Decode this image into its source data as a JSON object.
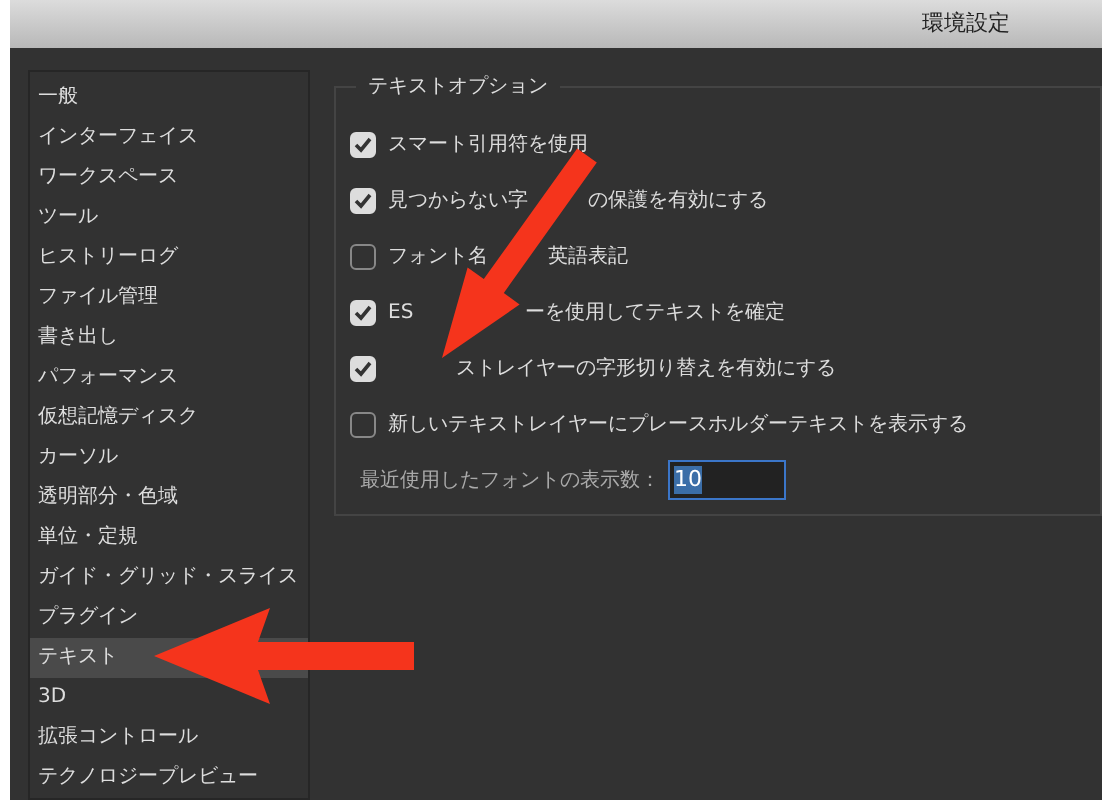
{
  "window": {
    "title": "環境設定"
  },
  "sidebar": {
    "items": [
      {
        "label": "一般",
        "selected": false
      },
      {
        "label": "インターフェイス",
        "selected": false
      },
      {
        "label": "ワークスペース",
        "selected": false
      },
      {
        "label": "ツール",
        "selected": false
      },
      {
        "label": "ヒストリーログ",
        "selected": false
      },
      {
        "label": "ファイル管理",
        "selected": false
      },
      {
        "label": "書き出し",
        "selected": false
      },
      {
        "label": "パフォーマンス",
        "selected": false
      },
      {
        "label": "仮想記憶ディスク",
        "selected": false
      },
      {
        "label": "カーソル",
        "selected": false
      },
      {
        "label": "透明部分・色域",
        "selected": false
      },
      {
        "label": "単位・定規",
        "selected": false
      },
      {
        "label": "ガイド・グリッド・スライス",
        "selected": false
      },
      {
        "label": "プラグイン",
        "selected": false
      },
      {
        "label": "テキスト",
        "selected": true
      },
      {
        "label": "3D",
        "selected": false
      },
      {
        "label": "拡張コントロール",
        "selected": false
      },
      {
        "label": "テクノロジープレビュー",
        "selected": false
      }
    ]
  },
  "text_options": {
    "title": "テキストオプション",
    "options": [
      {
        "label": "スマート引用符を使用",
        "checked": true
      },
      {
        "label_parts": [
          "見つからない字",
          "の保護を有効にする"
        ],
        "checked": true
      },
      {
        "label_parts": [
          "フォント名",
          "英語表記"
        ],
        "checked": false
      },
      {
        "label_parts": [
          "ES",
          "ーを使用してテキストを確定"
        ],
        "checked": true
      },
      {
        "label_parts": [
          "ストレイヤーの字形切り替えを有効にする"
        ],
        "cut_start": true,
        "checked": true
      },
      {
        "label": "新しいテキストレイヤーにプレースホルダーテキストを表示する",
        "checked": false
      }
    ],
    "recent_fonts": {
      "label": "最近使用したフォントの表示数：",
      "value": "10"
    }
  }
}
